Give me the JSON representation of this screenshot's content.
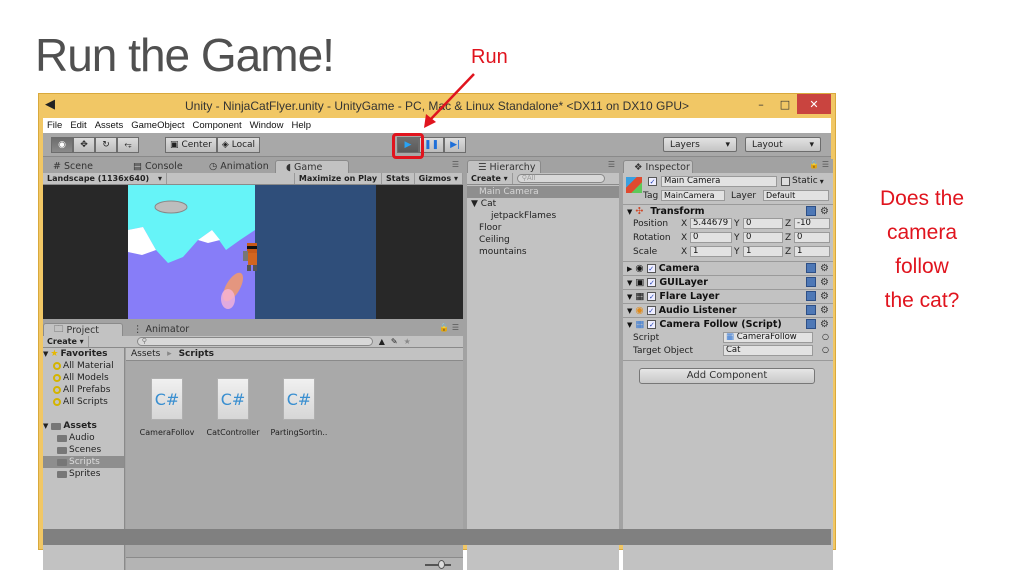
{
  "slide": {
    "title": "Run the Game!",
    "run_label": "Run",
    "annotation_lines": [
      "Does the",
      "camera",
      "follow",
      "the cat?"
    ]
  },
  "window": {
    "title": "Unity - NinjaCatFlyer.unity - UnityGame - PC, Mac & Linux Standalone* <DX11 on DX10 GPU>",
    "buttons": {
      "minimize": "–",
      "maximize": "□",
      "close": "✕"
    }
  },
  "menu": [
    "File",
    "Edit",
    "Assets",
    "GameObject",
    "Component",
    "Window",
    "Help"
  ],
  "toolbar": {
    "tools": [
      "hand-view",
      "move",
      "rotate",
      "scale"
    ],
    "pivot_label": "Center",
    "space_label": "Local",
    "play_state": "playing",
    "layers_label": "Layers",
    "layout_label": "Layout",
    "dropdown_arrow": "▾"
  },
  "scene_panel": {
    "tabs": [
      "Scene",
      "Console",
      "Animation",
      "Game"
    ],
    "active_tab": "Game",
    "resolution": "Landscape (1136x640)",
    "maximize_on_play": "Maximize on Play",
    "stats": "Stats",
    "gizmos": "Gizmos"
  },
  "hierarchy": {
    "tab": "Hierarchy",
    "create_label": "Create",
    "search_placeholder": "All",
    "items": [
      {
        "label": "Main Camera",
        "selected": true,
        "indent": 0
      },
      {
        "label": "▼ Cat",
        "selected": false,
        "indent": 0
      },
      {
        "label": "jetpackFlames",
        "selected": false,
        "indent": 1
      },
      {
        "label": "Floor",
        "selected": false,
        "indent": 0
      },
      {
        "label": "Ceiling",
        "selected": false,
        "indent": 0
      },
      {
        "label": "mountains",
        "selected": false,
        "indent": 0
      }
    ]
  },
  "inspector": {
    "tab": "Inspector",
    "object_name": "Main Camera",
    "static_label": "Static",
    "tag_label": "Tag",
    "tag_value": "MainCamera",
    "layer_label": "Layer",
    "layer_value": "Default",
    "transform": {
      "title": "Transform",
      "rows": [
        {
          "label": "Position",
          "x": "5.44679",
          "y": "0",
          "z": "-10"
        },
        {
          "label": "Rotation",
          "x": "0",
          "y": "0",
          "z": "0"
        },
        {
          "label": "Scale",
          "x": "1",
          "y": "1",
          "z": "1"
        }
      ]
    },
    "components": [
      "Camera",
      "GUILayer",
      "Flare Layer",
      "Audio Listener",
      "Camera Follow (Script)"
    ],
    "script_label": "Script",
    "script_value": "CameraFollow",
    "target_label": "Target Object",
    "target_value": "Cat",
    "add_component": "Add Component"
  },
  "project": {
    "tabs": [
      "Project",
      "Animator"
    ],
    "create_label": "Create",
    "favorites_label": "Favorites",
    "favorites": [
      "All Material",
      "All Models",
      "All Prefabs",
      "All Scripts"
    ],
    "assets_label": "Assets",
    "folders": [
      {
        "label": "Audio",
        "selected": false
      },
      {
        "label": "Scenes",
        "selected": false
      },
      {
        "label": "Scripts",
        "selected": true
      },
      {
        "label": "Sprites",
        "selected": false
      }
    ],
    "breadcrumb_root": "Assets",
    "breadcrumb_sep": "▸",
    "breadcrumb_current": "Scripts",
    "files": [
      "CameraFollov",
      "CatController",
      "PartingSortin.."
    ],
    "file_glyph": "C#"
  },
  "colors": {
    "annotation": "#e0141e",
    "window_frame": "#f1c765",
    "play_blue": "#29a3f5"
  }
}
